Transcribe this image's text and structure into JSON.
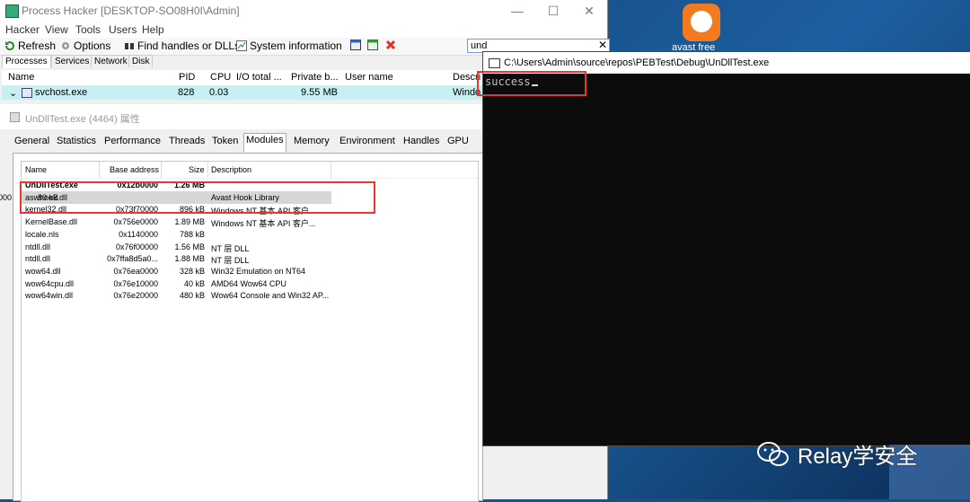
{
  "process_hacker": {
    "title": "Process Hacker [DESKTOP-SO08H0I\\Admin]",
    "window_buttons": {
      "minimize": "—",
      "maximize": "☐",
      "close": "✕"
    },
    "menu": [
      "Hacker",
      "View",
      "Tools",
      "Users",
      "Help"
    ],
    "toolbar": {
      "refresh": "Refresh",
      "options": "Options",
      "find_handles": "Find handles or DLLs",
      "system_information": "System information"
    },
    "search": {
      "value": "und",
      "clear": "✕"
    },
    "tabs": [
      "Processes",
      "Services",
      "Network",
      "Disk"
    ],
    "columns": [
      "Name",
      "PID",
      "CPU",
      "I/O total ...",
      "Private b...",
      "User name",
      "Descri"
    ],
    "process_row": {
      "name": "svchost.exe",
      "pid": "828",
      "cpu": "0.03",
      "private": "9.55 MB",
      "desc": "Windo"
    }
  },
  "properties": {
    "title": "UnDllTest.exe (4464) 属性",
    "tabs": [
      "General",
      "Statistics",
      "Performance",
      "Threads",
      "Token",
      "Modules",
      "Memory",
      "Environment",
      "Handles",
      "GPU"
    ],
    "active_tab": "Modules",
    "columns": [
      "Name",
      "Base address",
      "Size",
      "Description"
    ],
    "modules": [
      {
        "name": "UnDllTest.exe",
        "base": "0x12b0000",
        "size": "1.26 MB",
        "desc": ""
      },
      {
        "name": "aswhook.dll",
        "base": "0x5f740000",
        "size": "80 kB",
        "desc": "Avast Hook Library"
      },
      {
        "name": "kernel32.dll",
        "base": "0x73f70000",
        "size": "896 kB",
        "desc": "Windows NT 基本 API 客户..."
      },
      {
        "name": "KernelBase.dll",
        "base": "0x756e0000",
        "size": "1.89 MB",
        "desc": "Windows NT 基本 API 客户..."
      },
      {
        "name": "locale.nls",
        "base": "0x1140000",
        "size": "788 kB",
        "desc": ""
      },
      {
        "name": "ntdll.dll",
        "base": "0x76f00000",
        "size": "1.56 MB",
        "desc": "NT 层 DLL"
      },
      {
        "name": "ntdll.dll",
        "base": "0x7ffa8d5a0...",
        "size": "1.88 MB",
        "desc": "NT 层 DLL"
      },
      {
        "name": "wow64.dll",
        "base": "0x76ea0000",
        "size": "328 kB",
        "desc": "Win32 Emulation on NT64"
      },
      {
        "name": "wow64cpu.dll",
        "base": "0x76e10000",
        "size": "40 kB",
        "desc": "AMD64 Wow64 CPU"
      },
      {
        "name": "wow64win.dll",
        "base": "0x76e20000",
        "size": "480 kB",
        "desc": "Wow64 Console and Win32 AP..."
      }
    ]
  },
  "console": {
    "title": "C:\\Users\\Admin\\source\\repos\\PEBTest\\Debug\\UnDllTest.exe",
    "output": "success"
  },
  "desktop": {
    "avast_label": "avast free",
    "watermark": "Relay学安全"
  },
  "colors": {
    "highlight_red": "#e53935",
    "console_bg": "#0c0c0c",
    "process_row": "#c7f0f5"
  }
}
